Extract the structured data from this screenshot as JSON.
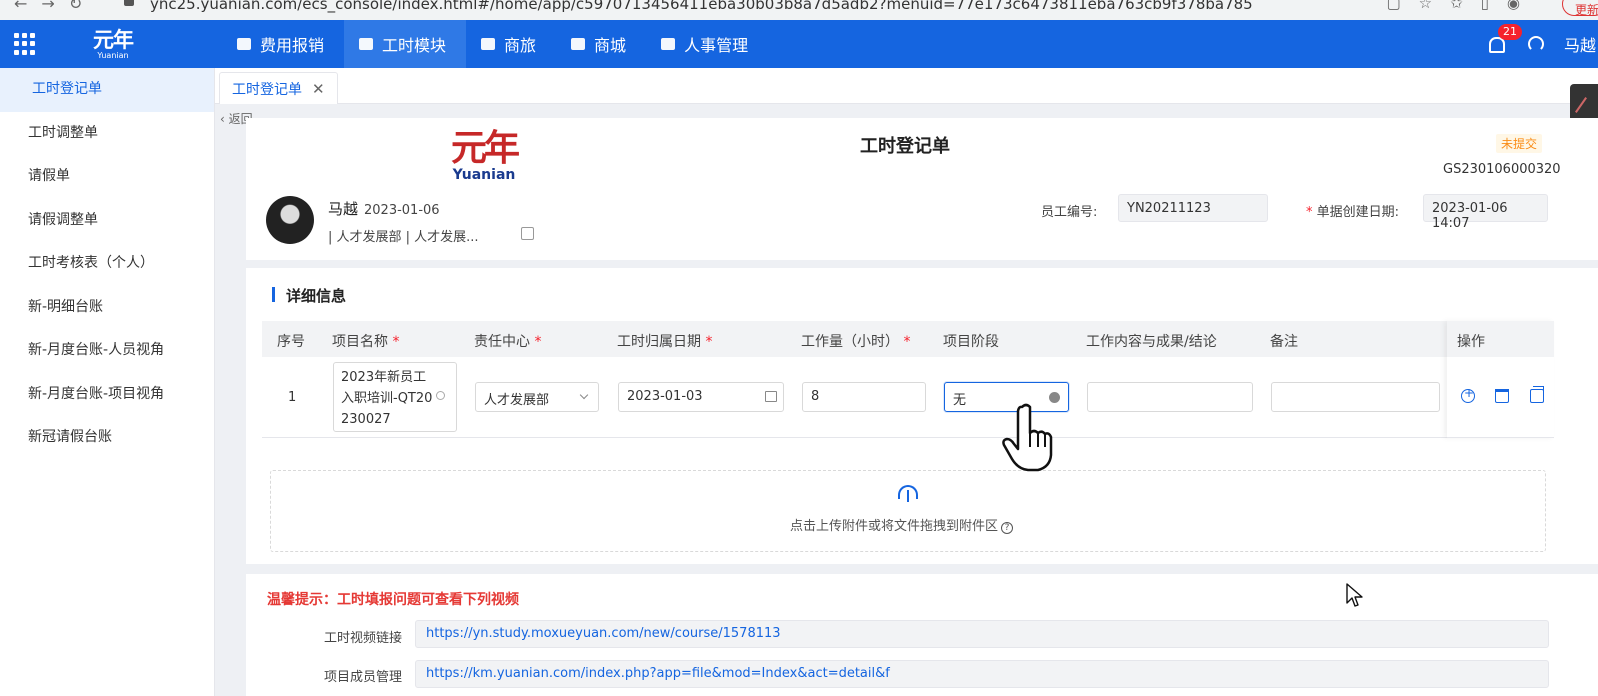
{
  "browser": {
    "url": "ync25.yuanian.com/ecs_console/index.html#/home/app/c5970713456411eba30b03b8a7d5adb2?menuid=77e173c6473811eba763cb9f378ba785",
    "update_label": "更新"
  },
  "topnav": {
    "logo_cn": "元年",
    "logo_en": "Yuanian",
    "menu": [
      {
        "label": "费用报销",
        "icon": "expense-icon"
      },
      {
        "label": "工时模块",
        "icon": "building-icon"
      },
      {
        "label": "商旅",
        "icon": "suitcase-icon"
      },
      {
        "label": "商城",
        "icon": "store-icon"
      },
      {
        "label": "人事管理",
        "icon": "people-icon"
      }
    ],
    "notification_count": "21",
    "user_name": "马越"
  },
  "sidebar": {
    "items": [
      {
        "label": "工时登记单"
      },
      {
        "label": "工时调整单"
      },
      {
        "label": "请假单"
      },
      {
        "label": "请假调整单"
      },
      {
        "label": "工时考核表（个人）"
      },
      {
        "label": "新-明细台账"
      },
      {
        "label": "新-月度台账-人员视角"
      },
      {
        "label": "新-月度台账-项目视角"
      },
      {
        "label": "新冠请假台账"
      }
    ]
  },
  "tabs": [
    {
      "label": "工时登记单",
      "close": "✕"
    }
  ],
  "back_label": "返回",
  "doc": {
    "logo_cn": "元年",
    "logo_en": "Yuanian",
    "title": "工时登记单",
    "status": "未提交",
    "number": "GS230106000320",
    "person_name": "马越",
    "person_date": "2023-01-06",
    "dept": "| 人才发展部 | 人才发展...",
    "employee_no_label": "员工编号:",
    "employee_no": "YN20211123",
    "created_label": "单据创建日期:",
    "created": "2023-01-06 14:07"
  },
  "detail": {
    "section_title": "详细信息",
    "columns": [
      "序号",
      "项目名称",
      "责任中心",
      "工时归属日期",
      "工作量（小时）",
      "项目阶段",
      "工作内容与成果/结论",
      "备注",
      "操作"
    ],
    "row": {
      "index": "1",
      "project": "2023年新员工入职培训-QT20230027",
      "center": "人才发展部",
      "date": "2023-01-03",
      "hours": "8",
      "stage": "无",
      "content": "",
      "remark": ""
    }
  },
  "upload": {
    "text": "点击上传附件或将文件拖拽到附件区"
  },
  "tips": {
    "title": "温馨提示：工时填报问题可查看下列视频",
    "links": [
      {
        "label": "工时视频链接",
        "url": "https://yn.study.moxueyuan.com/new/course/1578113"
      },
      {
        "label": "项目成员管理",
        "url": "https://km.yuanian.com/index.php?app=file&mod=Index&act=detail&f"
      }
    ]
  },
  "colors": {
    "brand": "#1565e0",
    "danger": "#e53935",
    "warning": "#fa8c16"
  }
}
